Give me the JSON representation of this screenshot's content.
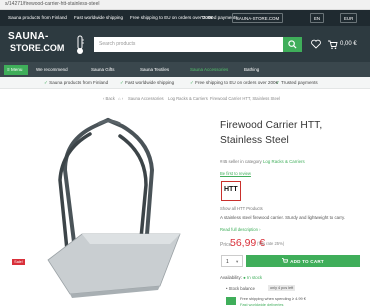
{
  "browser": {
    "url": "s/14271/firewood-carrier-htt-stainless-steel"
  },
  "topbar": {
    "promo_1": "Sauna products from Finland",
    "promo_2": "Fast worldwide shipping",
    "promo_3": "Free shipping to EU on orders over 200€",
    "promo_4": "Trusted payments",
    "site_select": "SAUNA-STORE.COM",
    "lang": "EN",
    "currency": "EUR"
  },
  "header": {
    "logo_line1": "SAUNA-",
    "logo_line2": "STORE.COM",
    "search_placeholder": "Search products",
    "cart_total": "0,00 €",
    "cart_count": "0"
  },
  "nav": {
    "menu": "Menu",
    "items": [
      "We recommend",
      "Sauna Gifts",
      "Sauna Textiles",
      "Sauna Accessories",
      "Bathing"
    ],
    "active_index": 3
  },
  "usp": [
    "Sauna products from Finland",
    "Fast worldwide shipping",
    "Free shipping to EU on orders over 200€",
    "Trusted payments"
  ],
  "breadcrumb": {
    "back": "‹ Back",
    "items": [
      "Sauna Accessories",
      "Log Racks & Carriers",
      "Firewood Carrier HTT, Stainless Steel"
    ]
  },
  "product": {
    "title": "Firewood Carrier HTT, Stainless Steel",
    "meta_prefix": "#45 seller in category",
    "meta_category": "Log Racks & Carriers",
    "review_link": "Be first to review",
    "brand_logo_text": "HTT",
    "show_all": "Show all HTT Products",
    "description": "A stainless steel firewood carrier. Sturdy and lightweight to carry.",
    "read_full": "Read full description ›",
    "price_label": "Price",
    "price": "56,99 €",
    "tax_note": "(Tax rate 25%)",
    "quantity": "1",
    "add_to_cart": "ADD TO CART",
    "availability_label": "Availability:",
    "availability_value": "In stock",
    "stock_note": "Stock balance",
    "only_left": "only 4 pcs left",
    "shipping_line1": "Free shipping when spending ≥ 4.99 €",
    "shipping_line2": "Fast worldwide deliveries",
    "sale_badge": "Sale!"
  },
  "colors": {
    "accent": "#3fae5a",
    "header_bg": "#2d3a40",
    "price": "#d9303a"
  }
}
